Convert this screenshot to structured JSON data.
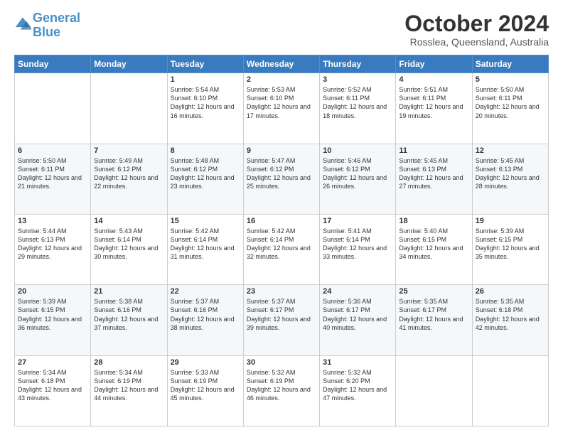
{
  "logo": {
    "line1": "General",
    "line2": "Blue"
  },
  "header": {
    "month": "October 2024",
    "location": "Rosslea, Queensland, Australia"
  },
  "days_of_week": [
    "Sunday",
    "Monday",
    "Tuesday",
    "Wednesday",
    "Thursday",
    "Friday",
    "Saturday"
  ],
  "weeks": [
    [
      {
        "day": "",
        "info": ""
      },
      {
        "day": "",
        "info": ""
      },
      {
        "day": "1",
        "info": "Sunrise: 5:54 AM\nSunset: 6:10 PM\nDaylight: 12 hours and 16 minutes."
      },
      {
        "day": "2",
        "info": "Sunrise: 5:53 AM\nSunset: 6:10 PM\nDaylight: 12 hours and 17 minutes."
      },
      {
        "day": "3",
        "info": "Sunrise: 5:52 AM\nSunset: 6:11 PM\nDaylight: 12 hours and 18 minutes."
      },
      {
        "day": "4",
        "info": "Sunrise: 5:51 AM\nSunset: 6:11 PM\nDaylight: 12 hours and 19 minutes."
      },
      {
        "day": "5",
        "info": "Sunrise: 5:50 AM\nSunset: 6:11 PM\nDaylight: 12 hours and 20 minutes."
      }
    ],
    [
      {
        "day": "6",
        "info": "Sunrise: 5:50 AM\nSunset: 6:11 PM\nDaylight: 12 hours and 21 minutes."
      },
      {
        "day": "7",
        "info": "Sunrise: 5:49 AM\nSunset: 6:12 PM\nDaylight: 12 hours and 22 minutes."
      },
      {
        "day": "8",
        "info": "Sunrise: 5:48 AM\nSunset: 6:12 PM\nDaylight: 12 hours and 23 minutes."
      },
      {
        "day": "9",
        "info": "Sunrise: 5:47 AM\nSunset: 6:12 PM\nDaylight: 12 hours and 25 minutes."
      },
      {
        "day": "10",
        "info": "Sunrise: 5:46 AM\nSunset: 6:12 PM\nDaylight: 12 hours and 26 minutes."
      },
      {
        "day": "11",
        "info": "Sunrise: 5:45 AM\nSunset: 6:13 PM\nDaylight: 12 hours and 27 minutes."
      },
      {
        "day": "12",
        "info": "Sunrise: 5:45 AM\nSunset: 6:13 PM\nDaylight: 12 hours and 28 minutes."
      }
    ],
    [
      {
        "day": "13",
        "info": "Sunrise: 5:44 AM\nSunset: 6:13 PM\nDaylight: 12 hours and 29 minutes."
      },
      {
        "day": "14",
        "info": "Sunrise: 5:43 AM\nSunset: 6:14 PM\nDaylight: 12 hours and 30 minutes."
      },
      {
        "day": "15",
        "info": "Sunrise: 5:42 AM\nSunset: 6:14 PM\nDaylight: 12 hours and 31 minutes."
      },
      {
        "day": "16",
        "info": "Sunrise: 5:42 AM\nSunset: 6:14 PM\nDaylight: 12 hours and 32 minutes."
      },
      {
        "day": "17",
        "info": "Sunrise: 5:41 AM\nSunset: 6:14 PM\nDaylight: 12 hours and 33 minutes."
      },
      {
        "day": "18",
        "info": "Sunrise: 5:40 AM\nSunset: 6:15 PM\nDaylight: 12 hours and 34 minutes."
      },
      {
        "day": "19",
        "info": "Sunrise: 5:39 AM\nSunset: 6:15 PM\nDaylight: 12 hours and 35 minutes."
      }
    ],
    [
      {
        "day": "20",
        "info": "Sunrise: 5:39 AM\nSunset: 6:15 PM\nDaylight: 12 hours and 36 minutes."
      },
      {
        "day": "21",
        "info": "Sunrise: 5:38 AM\nSunset: 6:16 PM\nDaylight: 12 hours and 37 minutes."
      },
      {
        "day": "22",
        "info": "Sunrise: 5:37 AM\nSunset: 6:16 PM\nDaylight: 12 hours and 38 minutes."
      },
      {
        "day": "23",
        "info": "Sunrise: 5:37 AM\nSunset: 6:17 PM\nDaylight: 12 hours and 39 minutes."
      },
      {
        "day": "24",
        "info": "Sunrise: 5:36 AM\nSunset: 6:17 PM\nDaylight: 12 hours and 40 minutes."
      },
      {
        "day": "25",
        "info": "Sunrise: 5:35 AM\nSunset: 6:17 PM\nDaylight: 12 hours and 41 minutes."
      },
      {
        "day": "26",
        "info": "Sunrise: 5:35 AM\nSunset: 6:18 PM\nDaylight: 12 hours and 42 minutes."
      }
    ],
    [
      {
        "day": "27",
        "info": "Sunrise: 5:34 AM\nSunset: 6:18 PM\nDaylight: 12 hours and 43 minutes."
      },
      {
        "day": "28",
        "info": "Sunrise: 5:34 AM\nSunset: 6:19 PM\nDaylight: 12 hours and 44 minutes."
      },
      {
        "day": "29",
        "info": "Sunrise: 5:33 AM\nSunset: 6:19 PM\nDaylight: 12 hours and 45 minutes."
      },
      {
        "day": "30",
        "info": "Sunrise: 5:32 AM\nSunset: 6:19 PM\nDaylight: 12 hours and 46 minutes."
      },
      {
        "day": "31",
        "info": "Sunrise: 5:32 AM\nSunset: 6:20 PM\nDaylight: 12 hours and 47 minutes."
      },
      {
        "day": "",
        "info": ""
      },
      {
        "day": "",
        "info": ""
      }
    ]
  ]
}
